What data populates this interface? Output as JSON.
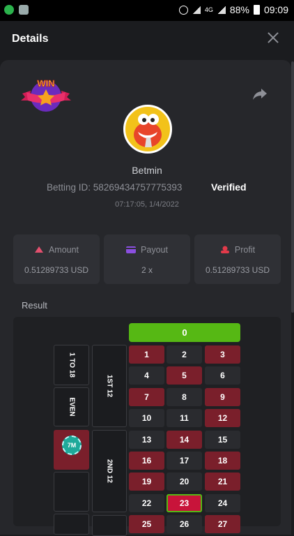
{
  "statusbar": {
    "network": "4G",
    "battery": "88%",
    "time": "09:09"
  },
  "header": {
    "title": "Details"
  },
  "bet": {
    "badge": "WIN",
    "username": "Betmin",
    "betting_id_label": "Betting ID:",
    "betting_id": "58269434757775393",
    "verified": "Verified",
    "time": "07:17:05, 1/4/2022"
  },
  "cards": [
    {
      "label": "Amount",
      "value": "0.51289733 USD"
    },
    {
      "label": "Payout",
      "value": "2 x"
    },
    {
      "label": "Profit",
      "value": "0.51289733 USD"
    }
  ],
  "result": {
    "title": "Result",
    "zero": "0",
    "side_labels": [
      "1 TO 18",
      "EVEN",
      "1ST 12",
      "2ND 12"
    ],
    "chip": "7M",
    "winning_number": "23",
    "rows": [
      [
        "1",
        "2",
        "3"
      ],
      [
        "4",
        "5",
        "6"
      ],
      [
        "7",
        "8",
        "9"
      ],
      [
        "10",
        "11",
        "12"
      ],
      [
        "13",
        "14",
        "15"
      ],
      [
        "16",
        "17",
        "18"
      ],
      [
        "19",
        "20",
        "21"
      ],
      [
        "22",
        "23",
        "24"
      ],
      [
        "25",
        "26",
        "27"
      ]
    ]
  },
  "colors": {
    "accent_green": "#56b814",
    "red": "#7a1f2b",
    "highlight": "#c8143a"
  }
}
